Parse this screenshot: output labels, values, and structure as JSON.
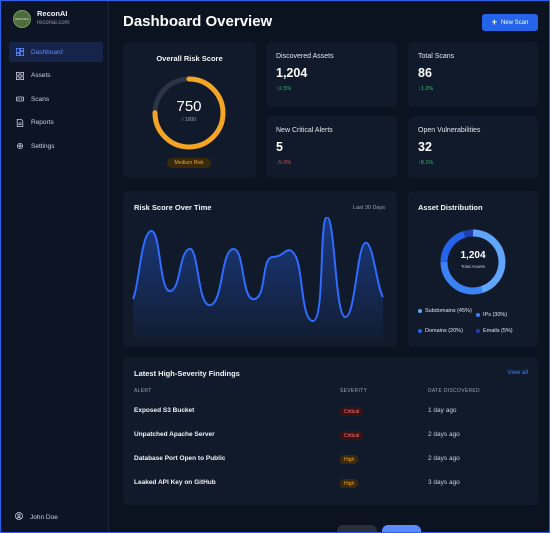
{
  "brand": {
    "name": "ReconAI",
    "url": "reconai.com",
    "logo_text": "RECONAI"
  },
  "sidebar": {
    "items": [
      {
        "label": "Dashboard",
        "icon": "dashboard-icon",
        "active": true
      },
      {
        "label": "Assets",
        "icon": "grid-icon",
        "active": false
      },
      {
        "label": "Scans",
        "icon": "radar-icon",
        "active": false
      },
      {
        "label": "Reports",
        "icon": "document-icon",
        "active": false
      },
      {
        "label": "Settings",
        "icon": "gear-icon",
        "active": false
      }
    ],
    "user": "John Doe"
  },
  "header": {
    "title": "Dashboard Overview",
    "new_scan_label": "New Scan"
  },
  "risk": {
    "title": "Overall Risk Score",
    "value": "750",
    "max": "/ 1000",
    "fraction": 0.75,
    "badge": "Medium Risk"
  },
  "stats": {
    "assets": {
      "label": "Discovered Assets",
      "value": "1,204",
      "change": "2.5%",
      "dir": "up"
    },
    "scans": {
      "label": "Total Scans",
      "value": "86",
      "change": "1.2%",
      "dir": "up"
    },
    "alerts": {
      "label": "New Critical Alerts",
      "value": "5",
      "change": "5.0%",
      "dir": "down"
    },
    "vulns": {
      "label": "Open Vulnerabilities",
      "value": "32",
      "change": "8.1%",
      "dir": "up"
    }
  },
  "trend": {
    "title": "Risk Score Over Time",
    "range": "Last 30 Days"
  },
  "distribution": {
    "title": "Asset Distribution",
    "total": "1,204",
    "total_label": "Total Assets",
    "legend": [
      {
        "label": "Subdomains (45%)",
        "percent": 45,
        "color": "#60a5fa"
      },
      {
        "label": "IPs (30%)",
        "percent": 30,
        "color": "#3b82f6"
      },
      {
        "label": "Domains (20%)",
        "percent": 20,
        "color": "#2563eb"
      },
      {
        "label": "Emails (5%)",
        "percent": 5,
        "color": "#1e40af"
      }
    ]
  },
  "findings": {
    "title": "Latest High-Severity Findings",
    "view_all": "View all",
    "columns": [
      "ALERT",
      "SEVERITY",
      "DATE DISCOVERED"
    ],
    "rows": [
      {
        "alert": "Exposed S3 Bucket",
        "severity": "Critical",
        "date": "1 day ago"
      },
      {
        "alert": "Unpatched Apache Server",
        "severity": "Critical",
        "date": "2 days ago"
      },
      {
        "alert": "Database Port Open to Public",
        "severity": "High",
        "date": "2 days ago"
      },
      {
        "alert": "Leaked API Key on GitHub",
        "severity": "High",
        "date": "3 days ago"
      }
    ]
  },
  "colors": {
    "accent": "#2563eb",
    "gauge": "#f5a524",
    "up": "#22c55e",
    "down": "#ef4444"
  }
}
